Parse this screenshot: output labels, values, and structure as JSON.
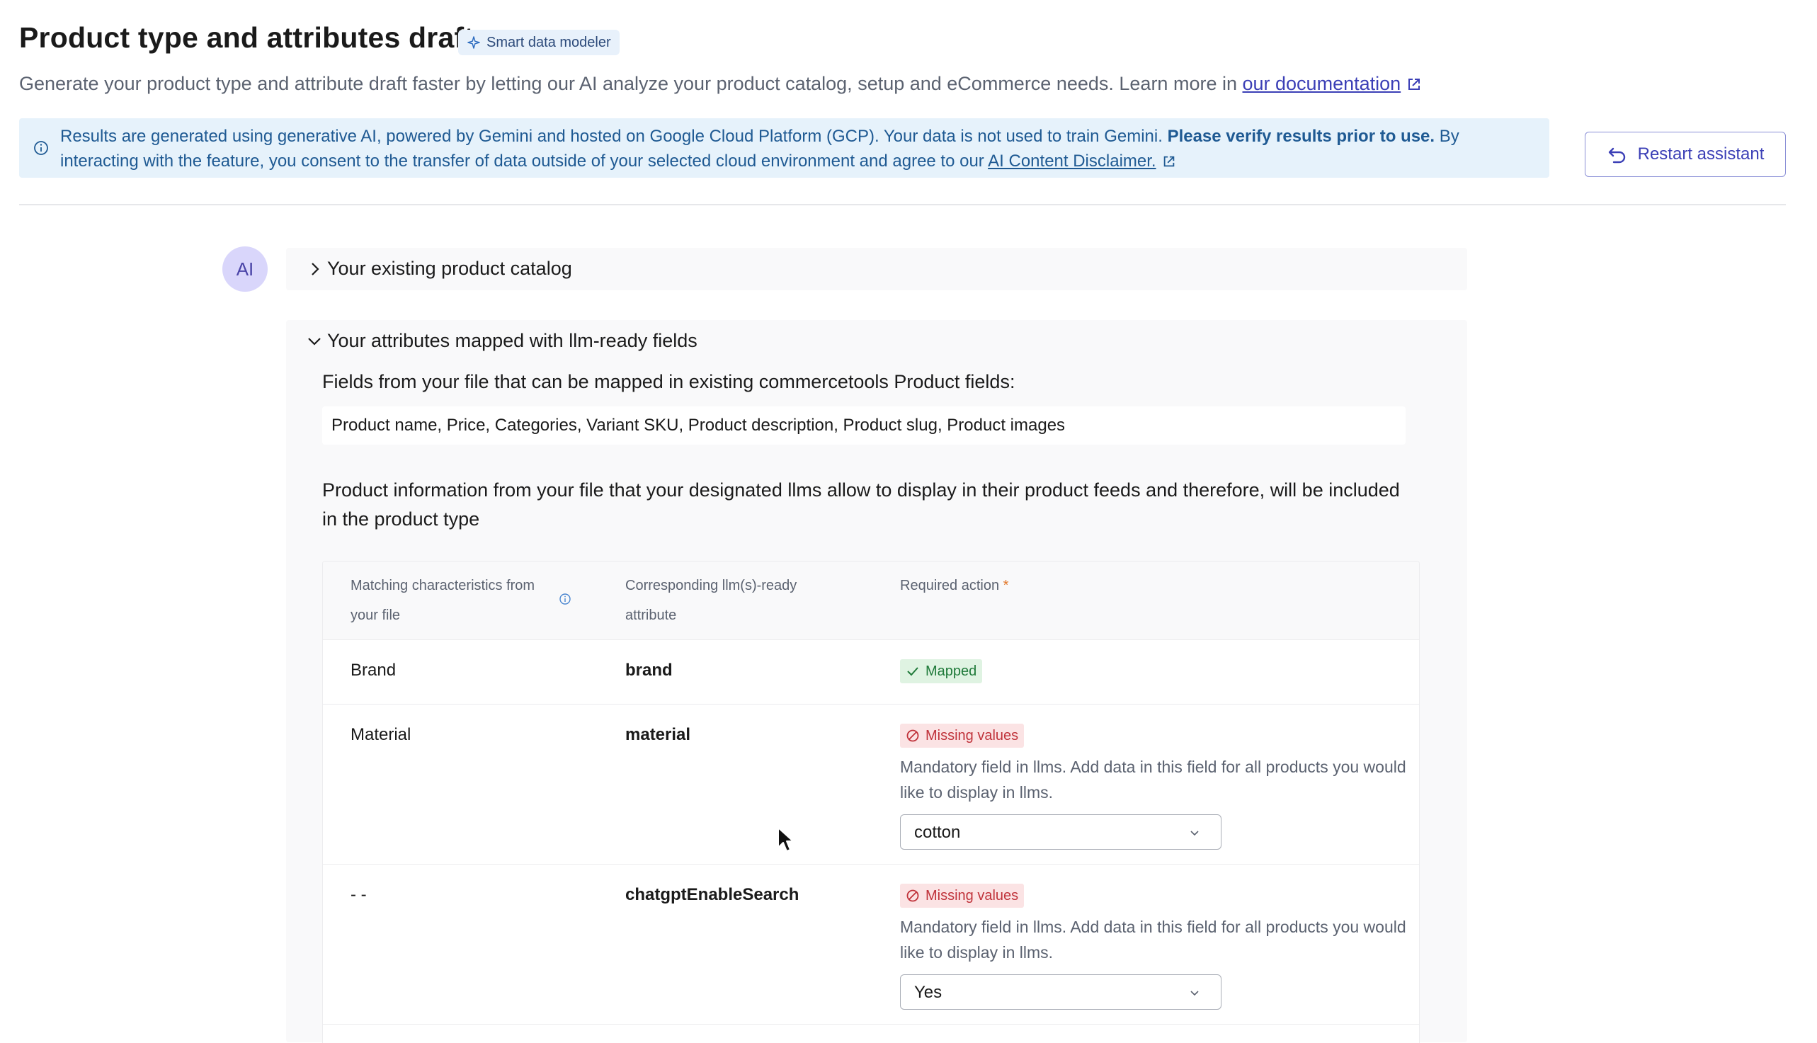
{
  "header": {
    "title": "Product type and attributes draft",
    "tag_label": "Smart data modeler",
    "subtitle_text": "Generate your product type and attribute draft faster by letting our AI analyze your product catalog, setup and eCommerce needs. Learn more in",
    "doc_link": "our documentation"
  },
  "banner": {
    "text_part1": "Results are generated using generative AI, powered by Gemini and hosted on Google Cloud Platform (GCP). Your data is not used to train Gemini.",
    "text_bold": "Please verify results prior to use.",
    "text_part2": "By interacting with the feature, you consent to the transfer of data outside of your selected cloud environment and agree to our",
    "disclaimer_link": "AI Content Disclaimer.",
    "restart_label": "Restart assistant"
  },
  "assistant": {
    "avatar": "AI",
    "section1_label": "Your existing product catalog",
    "section2_label": "Your attributes mapped with llm-ready fields",
    "fields_label": "Fields from your file that can be mapped in existing commercetools Product fields:",
    "fields_value": "Product name, Price, Categories, Variant SKU, Product description, Product slug, Product images",
    "info_paragraph": "Product information from your file that your designated llms allow to display in their product feeds and therefore, will be included in the product type"
  },
  "table": {
    "headers": {
      "col1": "Matching characteristics from your file",
      "col2": "Corresponding llm(s)-ready attribute",
      "col3": "Required action",
      "required_marker": "*"
    },
    "rows": [
      {
        "source": "Brand",
        "attribute": "brand",
        "status": "Mapped"
      },
      {
        "source": "Material",
        "attribute": "material",
        "status": "Missing values",
        "note": "Mandatory field in llms. Add data in this field for all products you would like to display in llms.",
        "select_value": "cotton"
      },
      {
        "source": "- -",
        "attribute": "chatgptEnableSearch",
        "status": "Missing values",
        "note": "Mandatory field in llms. Add data in this field for all products you would like to display in llms.",
        "select_value": "Yes"
      }
    ]
  },
  "colors": {
    "accent": "#3b3fb6",
    "banner_bg": "#e6f2fb",
    "banner_text": "#1f5a93",
    "mapped_bg": "#dff3e2",
    "missing_bg": "#fbe3e4"
  }
}
